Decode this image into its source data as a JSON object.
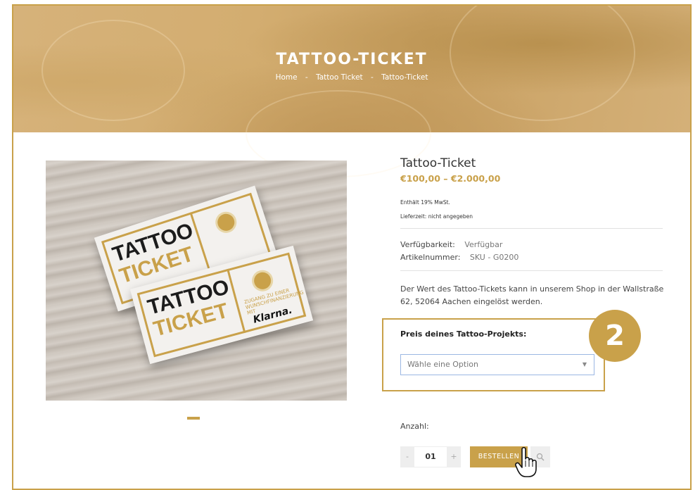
{
  "hero": {
    "title": "TATTOO-TICKET",
    "breadcrumb": [
      "Home",
      "Tattoo Ticket",
      "Tattoo-Ticket"
    ],
    "separator": "-"
  },
  "product": {
    "image_ticket_line1": "TATTOO",
    "image_ticket_line2": "TICKET",
    "image_ticket_small": "ZUGANG ZU EINER WUNSCHFINANZIERUNG MIT",
    "image_ticket_brand": "Klarna.",
    "title": "Tattoo-Ticket",
    "price": "€100,00 – €2.000,00",
    "tax_note": "Enthält 19% MwSt.",
    "delivery_note": "Lieferzeit: nicht angegeben",
    "availability_label": "Verfügbarkeit:",
    "availability_value": "Verfügbar",
    "sku_label": "Artikelnummer:",
    "sku_value": "SKU - G0200",
    "description": "Der Wert des Tattoo-Tickets kann in unserem Shop in der Wallstraße 62, 52064 Aachen eingelöst werden."
  },
  "option": {
    "label": "Preis deines Tattoo-Projekts:",
    "placeholder": "Wähle eine Option",
    "step_badge": "2"
  },
  "quantity": {
    "label": "Anzahl:",
    "minus": "-",
    "value": "01",
    "plus": "+"
  },
  "buttons": {
    "order": "BESTELLEN",
    "search_icon": "search-icon"
  },
  "colors": {
    "accent": "#c9a14a",
    "hero": "#d3ad70"
  }
}
